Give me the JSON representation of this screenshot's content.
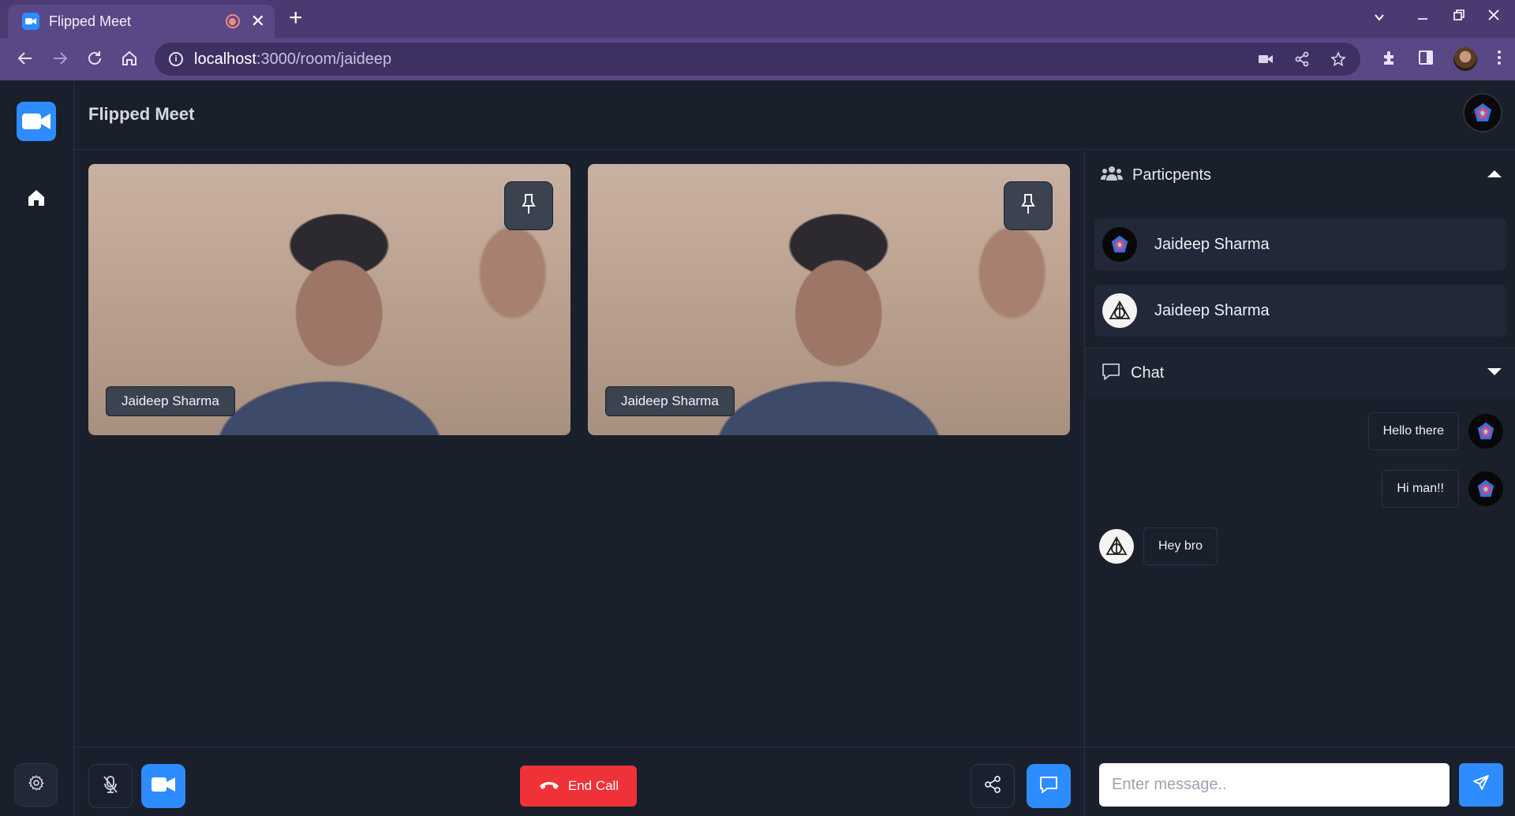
{
  "browser": {
    "tab_title": "Flipped Meet",
    "tab_close": "✕",
    "new_tab": "+",
    "url_host": "localhost",
    "url_path": ":3000/room/jaideep",
    "controls": {
      "minimize": "—",
      "restore": "❐",
      "close": "✕",
      "tab_search": "⌄"
    }
  },
  "app": {
    "title": "Flipped Meet",
    "accent": "#2d8cff",
    "danger": "#ef3138"
  },
  "tiles": [
    {
      "name": "Jaideep Sharma"
    },
    {
      "name": "Jaideep Sharma"
    }
  ],
  "controls": {
    "end_call": "End Call"
  },
  "participants": {
    "heading": "Particpents",
    "items": [
      {
        "name": "Jaideep Sharma",
        "avatar": "crystal-avatar"
      },
      {
        "name": "Jaideep Sharma",
        "avatar": "deathly-hallows-avatar"
      }
    ]
  },
  "chat": {
    "heading": "Chat",
    "messages": [
      {
        "text": "Hello there",
        "mine": true
      },
      {
        "text": "Hi man!!",
        "mine": true
      },
      {
        "text": "Hey bro",
        "mine": false
      }
    ],
    "input_placeholder": "Enter message.."
  }
}
